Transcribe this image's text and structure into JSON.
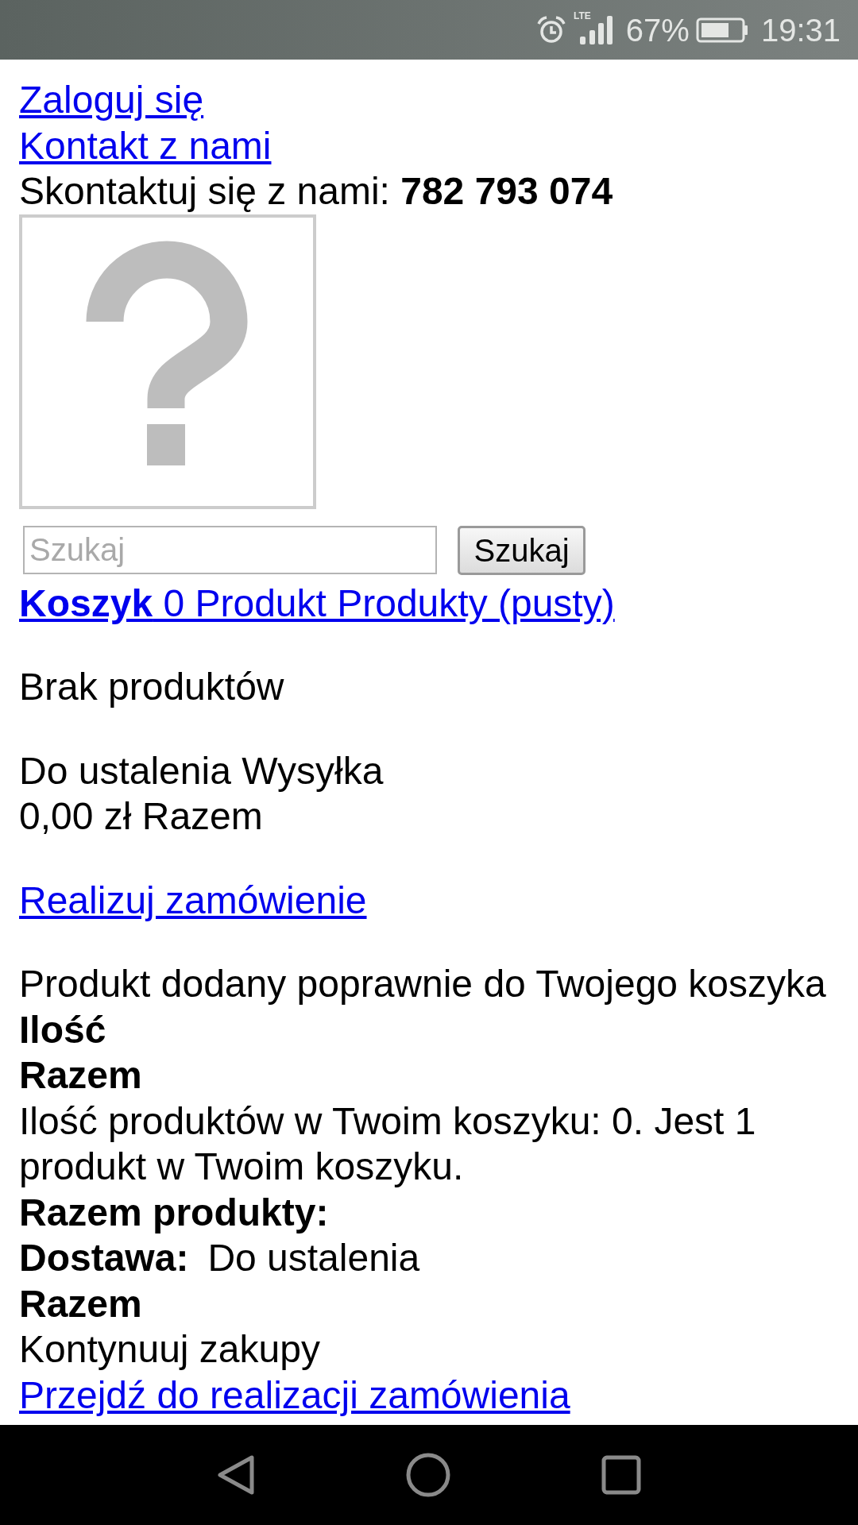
{
  "status_bar": {
    "network": "LTE",
    "battery": "67%",
    "time": "19:31"
  },
  "header": {
    "links": [
      "Zaloguj się",
      "Kontakt z nami"
    ],
    "contact": "Skontaktuj się z nami: **782 793 074**"
  },
  "search": {
    "placeholder": "Szukaj",
    "button": "Szukaj"
  },
  "cart": {
    "link": "**Koszyk** 0 Produkt Produkty (pusty)",
    "empty_message": "Brak produktów",
    "shipping": "Do ustalenia Wysyłka",
    "total": "0,00 zł Razem",
    "checkout_link": "Realizuj zamówienie"
  },
  "added_popup": {
    "message": "Produkt dodany poprawnie do Twojego koszyka",
    "quantity_label": "Ilość",
    "total_label": "Razem",
    "count_text": "Ilość produktów w Twoim koszyku: 0. Jest 1 produkt w Twoim koszyku.",
    "products_total_label": "Razem produkty:",
    "shipping_label": "Dostawa:",
    "shipping_value": "Do ustalenia",
    "grand_total_label": "Razem",
    "continue_text": "Kontynuuj zakupy",
    "checkout_link": "Przejdź do realizacji zamówienia"
  }
}
